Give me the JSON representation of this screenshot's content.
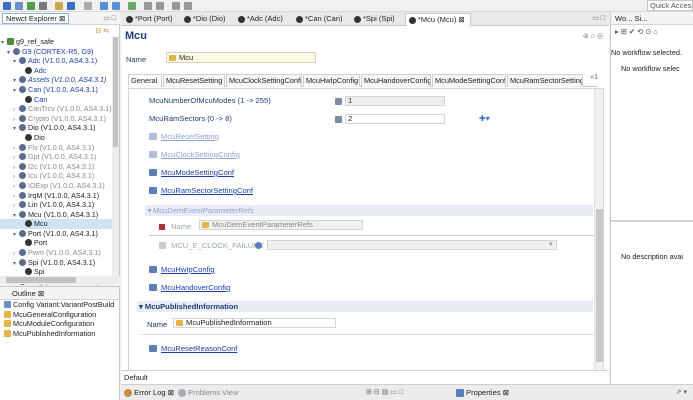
{
  "toolbar": {
    "quick_access": "Quick Access"
  },
  "explorer": {
    "tab_label": "New",
    "tab_label_rest": "ct Explorer",
    "items": [
      {
        "text": "g9_ref_safe",
        "level": 0,
        "kind": "proj",
        "cls": ""
      },
      {
        "text": "G9 (CORTEX-R5, G9)",
        "level": 1,
        "kind": "pkg",
        "cls": "blue"
      },
      {
        "text": "Adc (V1.0.0, AS4.3.1)",
        "level": 2,
        "kind": "pkg",
        "cls": "blue"
      },
      {
        "text": "Adc",
        "level": 3,
        "kind": "cfg",
        "cls": "blue"
      },
      {
        "text": "Assets (V1.0.0, AS4.3.1)",
        "level": 2,
        "kind": "pkg",
        "cls": "blue italic"
      },
      {
        "text": "Can (V1.0.0, AS4.3.1)",
        "level": 2,
        "kind": "pkg",
        "cls": "blue"
      },
      {
        "text": "Can",
        "level": 3,
        "kind": "cfg",
        "cls": "blue"
      },
      {
        "text": "CanTrcv (V1.0.0, AS4.3.1)",
        "level": 2,
        "kind": "pkg",
        "cls": "grey"
      },
      {
        "text": "Crypto (V1.0.0, AS4.3.1)",
        "level": 2,
        "kind": "pkg",
        "cls": "grey"
      },
      {
        "text": "Dio (V1.0.0, AS4.3.1)",
        "level": 2,
        "kind": "pkg",
        "cls": ""
      },
      {
        "text": "Dio",
        "level": 3,
        "kind": "cfg",
        "cls": ""
      },
      {
        "text": "Fls (V1.0.0, AS4.3.1)",
        "level": 2,
        "kind": "pkg",
        "cls": "grey"
      },
      {
        "text": "Gpt (V1.0.0, AS4.3.1)",
        "level": 2,
        "kind": "pkg",
        "cls": "grey"
      },
      {
        "text": "I2c (V1.0.0, AS4.3.1)",
        "level": 2,
        "kind": "pkg",
        "cls": "grey"
      },
      {
        "text": "Icu (V1.0.0, AS4.3.1)",
        "level": 2,
        "kind": "pkg",
        "cls": "grey"
      },
      {
        "text": "IOExp (V1.0.0, AS4.3.1)",
        "level": 2,
        "kind": "pkg",
        "cls": "grey"
      },
      {
        "text": "IrqM (V1.0.0, AS4.3.1)",
        "level": 2,
        "kind": "pkg",
        "cls": ""
      },
      {
        "text": "Lin (V1.0.0, AS4.3.1)",
        "level": 2,
        "kind": "pkg",
        "cls": ""
      },
      {
        "text": "Mcu (V1.0.0, AS4.3.1)",
        "level": 2,
        "kind": "pkg",
        "cls": ""
      },
      {
        "text": "Mcu",
        "level": 3,
        "kind": "cfg",
        "cls": "sel"
      },
      {
        "text": "Port (V1.0.0, AS4.3.1)",
        "level": 2,
        "kind": "pkg",
        "cls": ""
      },
      {
        "text": "Port",
        "level": 3,
        "kind": "cfg",
        "cls": ""
      },
      {
        "text": "Pwm (V1.0.0, AS4.3.1)",
        "level": 2,
        "kind": "pkg",
        "cls": "grey"
      },
      {
        "text": "Spi (V1.0.0, AS4.3.1)",
        "level": 2,
        "kind": "pkg",
        "cls": ""
      },
      {
        "text": "Spi",
        "level": 3,
        "kind": "cfg",
        "cls": ""
      },
      {
        "text": "Wdg (V1.0.0, AS4.3.1)",
        "level": 2,
        "kind": "pkg",
        "cls": "grey"
      }
    ]
  },
  "outline": {
    "title": "Outline",
    "items": [
      "Config Variant:VariantPostBuild",
      "McuGeneralConfiguration",
      "McuModuleConfiguration",
      "McuPublishedInformation"
    ]
  },
  "editor_tabs": [
    "*Port (Port)",
    "*Dio (Dio)",
    "*Adc (Adc)",
    "*Can (Can)",
    "*Spi (Spi)",
    "*Mcu (Mcu)"
  ],
  "editor": {
    "title": "Mcu",
    "name_label": "Name",
    "name_value": "Mcu",
    "subtabs": [
      "General",
      "McuResetSetting",
      "McuClockSettingConfi",
      "McuHwIpConfig",
      "McuHandoverConfig",
      "McuModeSettingConf",
      "McuRamSectorSettingC"
    ],
    "more": "»1",
    "params": [
      {
        "label": "McuNumberOfMcuModes (1 -> 255)",
        "value": "1"
      },
      {
        "label": "McuRamSectors (0 -> 8)",
        "value": "2"
      }
    ],
    "links": {
      "reset_setting": "McuResetSetting",
      "clock_setting": "McuClockSettingConfig",
      "mode_setting": "McuModeSettingConf",
      "ram_sector": "McuRamSectorSettingConf",
      "hw_ip": "McuHwIpConfig",
      "handover": "McuHandoverConfig",
      "reset_reason": "McuResetReasonConf"
    },
    "dem_section": {
      "title": "McuDemEventParameterRefs",
      "name_label": "Name",
      "name_value": "McuDemEventParameterRefs",
      "clock_failure": "MCU_E_CLOCK_FAILURE"
    },
    "published": {
      "title": "McuPublishedInformation",
      "name_label": "Name",
      "name_value": "McuPublishedInformation"
    },
    "default_tab": "Default"
  },
  "bottom": {
    "error_log": "Error Log",
    "problems": "Problems View",
    "properties": "Properties"
  },
  "right": {
    "tabs": "Wo...  Si...",
    "line1": "No workflow selected.",
    "line2": "No workflow selec",
    "line3": "No description avai"
  }
}
